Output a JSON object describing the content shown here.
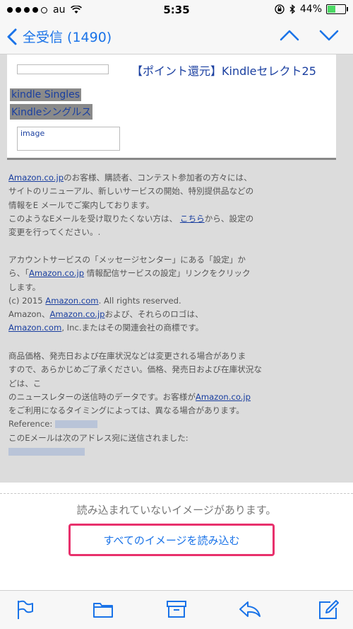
{
  "status_bar": {
    "carrier": "au",
    "time": "5:35",
    "battery": "44%",
    "battery_level": 0.44
  },
  "nav": {
    "back_label": "全受信 (1490)"
  },
  "email": {
    "promo_title": "【ポイント還元】Kindleセレクト25",
    "tag1": "kindle Singles",
    "tag2": "Kindleシングルス",
    "image_alt": "image",
    "p1_link": "Amazon.co.jp",
    "p1_text1": "のお客様、購読者、コンテスト参加者の方々には、",
    "p1_text2": "サイトのリニューアル、新しいサービスの開始、特別提供品などの",
    "p1_text3": "情報をE メールでご案内しております。",
    "p1_text4a": "このようなEメールを受け取りたくない方は、",
    "p1_link2": "こちら",
    "p1_text4b": "から、設定の",
    "p1_text5": "変更を行ってください。.",
    "p2_text1": "アカウントサービスの「メッセージセンター」にある「設定」か",
    "p2_text2a": "ら、「",
    "p2_link": "Amazon.co.jp",
    "p2_text2b": " 情報配信サービスの設定」リンクをクリック",
    "p2_text3": "します。",
    "p3_text1a": "(c) 2015 ",
    "p3_link1": "Amazon.com",
    "p3_text1b": ". All rights reserved.",
    "p3_text2a": "Amazon、",
    "p3_link2": "Amazon.co.jp",
    "p3_text2b": "および、それらのロゴは、",
    "p3_link3": "Amazon.com",
    "p3_text3": ", Inc.またはその関連会社の商標です。",
    "p4_text1": "商品価格、発売日および在庫状況などは変更される場合がありま",
    "p4_text2": "すので、あらかじめご了承ください。価格、発売日および在庫状況な",
    "p4_text3": "どは、こ",
    "p4_text4a": "のニュースレターの送信時のデータです。お客様が",
    "p4_link": "Amazon.co.jp",
    "p4_text5": "をご利用になるタイミングによっては、異なる場合があります。",
    "reference_label": "Reference:",
    "sent_to": "このEメールは次のアドレス宛に送信されました:"
  },
  "images_notice": "読み込まれていないイメージがあります。",
  "load_images_button": "すべてのイメージを読み込む",
  "colors": {
    "accent": "#1a73e8",
    "highlight_border": "#e8316c"
  }
}
